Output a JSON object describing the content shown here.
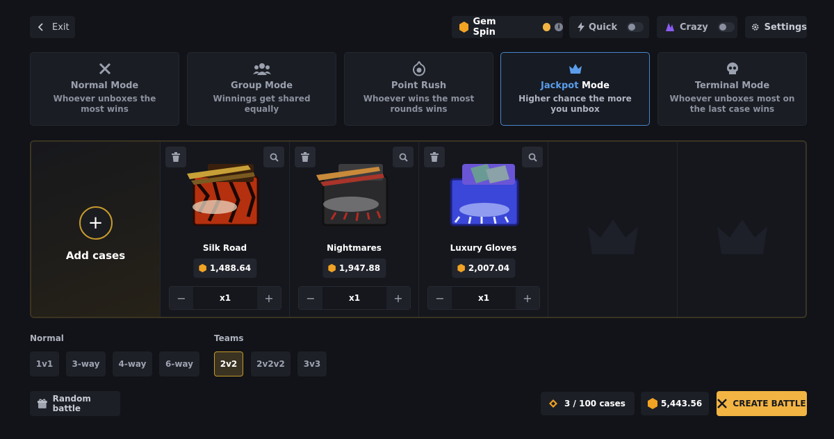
{
  "topbar": {
    "exit_label": "Exit",
    "gem_spin_label": "Gem Spin",
    "quick_label": "Quick",
    "crazy_label": "Crazy",
    "settings_label": "Settings"
  },
  "modes": [
    {
      "title": "Normal Mode",
      "desc": "Whoever unboxes the most wins",
      "icon": "crossed-swords-icon"
    },
    {
      "title": "Group Mode",
      "desc": "Winnings get shared equally",
      "icon": "group-icon"
    },
    {
      "title": "Point Rush",
      "desc": "Whoever wins the most rounds wins",
      "icon": "point-icon"
    },
    {
      "title_highlight": "Jackpot",
      "title_rest": " Mode",
      "desc": "Higher chance the more you unbox",
      "icon": "crown-icon",
      "active": true
    },
    {
      "title": "Terminal Mode",
      "desc": "Whoever unboxes most on the last case wins",
      "icon": "skull-icon"
    }
  ],
  "add_cases_label": "Add cases",
  "cases": [
    {
      "name": "Silk Road",
      "price": "1,488.64",
      "qty": "x1"
    },
    {
      "name": "Nightmares",
      "price": "1,947.88",
      "qty": "x1"
    },
    {
      "name": "Luxury Gloves",
      "price": "2,007.04",
      "qty": "x1"
    }
  ],
  "battle_types": {
    "normal_label": "Normal",
    "teams_label": "Teams",
    "normal_options": [
      "1v1",
      "3-way",
      "4-way",
      "6-way"
    ],
    "team_options": [
      "2v2",
      "2v2v2",
      "3v3"
    ],
    "selected": "2v2"
  },
  "footer": {
    "random_battle_label": "Random battle",
    "cases_count": "3 / 100 cases",
    "total_cost": "5,443.56",
    "create_battle_label": "CREATE BATTLE"
  },
  "colors": {
    "accent_gold": "#f2b443",
    "active_mode_border": "#4a86c8",
    "jackpot_blue": "#5b9dea",
    "background": "#111318"
  }
}
